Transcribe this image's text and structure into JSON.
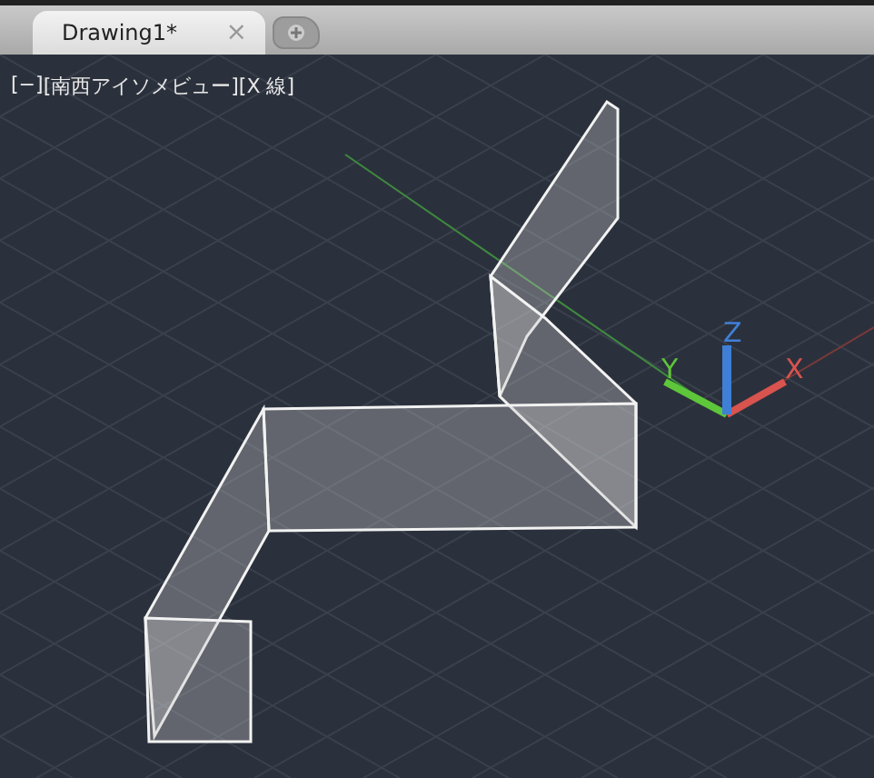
{
  "tabs": [
    {
      "label": "Drawing1*",
      "selected": true,
      "close": "×"
    }
  ],
  "viewport": {
    "controls": [
      "[−]",
      "[南西アイソメビュー]",
      "[X 線]"
    ]
  },
  "axes": [
    {
      "label": "X",
      "color": "#d9534f"
    },
    {
      "label": "Y",
      "color": "#5ec63a"
    },
    {
      "label": "Z",
      "color": "#3f7fd6"
    }
  ]
}
